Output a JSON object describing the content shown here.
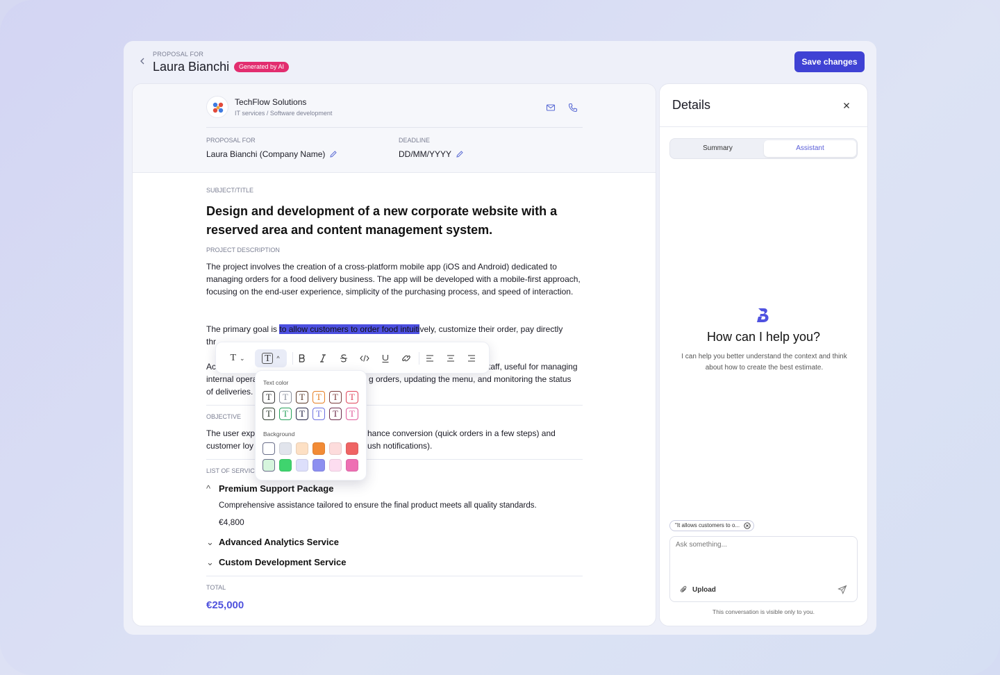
{
  "header": {
    "eyebrow": "PROPOSAL FOR",
    "client_name": "Laura Bianchi",
    "ai_badge": "Generated by AI",
    "save_label": "Save changes"
  },
  "company": {
    "name": "TechFlow Solutions",
    "subtitle": "IT services / Software development",
    "proposal_for_label": "PROPOSAL FOR",
    "proposal_for_value": "Laura Bianchi (Company Name)",
    "deadline_label": "DEADLINE",
    "deadline_value": "DD/MM/YYYY"
  },
  "document": {
    "subject_label": "SUBJECT/TITLE",
    "title": "Design and development of a new corporate website with a reserved area and content management system.",
    "description_label": "PROJECT DESCRIPTION",
    "description_p1": "The project involves the creation of a cross-platform mobile app (iOS and Android) dedicated to managing orders for a food delivery business. The app will be developed with a mobile-first approach, focusing on the end-user experience, simplicity of the purchasing process, and speed of interaction.",
    "p2_before": "The primary goal is ",
    "p2_highlight": "to allow customers to order food intuiti",
    "p2_after": "vely, customize their order, pay directly",
    "p2_line2": "thr",
    "p3_line1_start": "Ac",
    "p3_line1_end": "taff, useful for managing",
    "p3_line2_start": "internal opera",
    "p3_line2_end": "g orders, updating the menu, and monitoring the status",
    "p3_line3": "of deliveries.",
    "objective_label": "OBJECTIVE",
    "obj_line1_start": "The user exp",
    "obj_line1_end": "hance conversion (quick orders in a few steps) and",
    "obj_line2_start": "customer loy",
    "obj_line2_end": "ush notifications).",
    "services_label": "LIST OF SERVICE",
    "services": [
      {
        "name": "Premium Support Package",
        "expanded": true,
        "description": "Comprehensive assistance tailored to ensure the final product meets all quality standards.",
        "price": "€4,800"
      },
      {
        "name": "Advanced Analytics Service",
        "expanded": false
      },
      {
        "name": "Custom Development Service",
        "expanded": false
      }
    ],
    "total_label": "TOTAL",
    "total_value": "€25,000"
  },
  "toolbar": {
    "items": [
      "text-style",
      "text-color",
      "bold",
      "italic",
      "strikethrough",
      "code",
      "underline",
      "link",
      "align-left",
      "align-center",
      "align-right"
    ],
    "text_color_label": "Text color",
    "background_label": "Background",
    "glyph": "T",
    "text_colors_row1": [
      "#333333",
      "#8a8f9c",
      "#5a3a2a",
      "#e67e22",
      "#7a3b3b",
      "#e0455a"
    ],
    "text_colors_row2": [
      "#2b3a2b",
      "#27a05a",
      "#222244",
      "#6b6fe0",
      "#6a2a4a",
      "#e05a9a"
    ],
    "bg_colors_row1": [
      "#ffffff",
      "#e1e4ec",
      "#fde0c4",
      "#f28b35",
      "#fddcdc",
      "#ef6464"
    ],
    "bg_colors_row2": [
      "#d6f5dd",
      "#3fd46e",
      "#dddffb",
      "#8c8ff0",
      "#fdddf0",
      "#ee6fb3"
    ]
  },
  "details": {
    "title": "Details",
    "tabs": [
      "Summary",
      "Assistant"
    ],
    "active_tab": "Assistant",
    "assistant_title": "How can I help you?",
    "assistant_desc": "I can help you better understand the context and think about how to create the best estimate.",
    "chip": "\"It allows customers to o...",
    "ask_placeholder": "Ask something...",
    "upload_label": "Upload",
    "visibility_note": "This conversation is visible only to you."
  },
  "colors": {
    "accent": "#3f42d4",
    "badge": "#e22d6f",
    "highlight": "#4c4fe0",
    "total": "#4f52dd"
  }
}
